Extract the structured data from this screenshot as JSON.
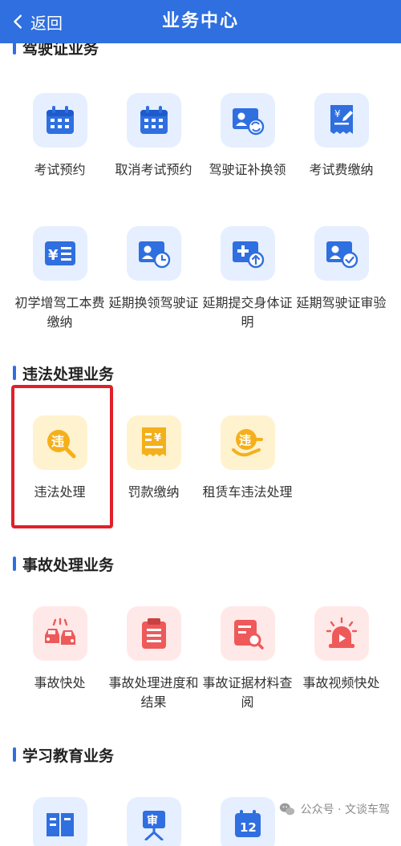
{
  "navbar": {
    "back_label": "返回",
    "title": "业务中心"
  },
  "colors": {
    "primary": "#2f6fe0",
    "highlight": "#e0202a",
    "yellow": "#f4b01c",
    "red": "#ee5a5a"
  },
  "sections": [
    {
      "title": "驾驶证业务",
      "items": [
        {
          "label": "考试预约",
          "icon": "calendar-icon"
        },
        {
          "label": "取消考试预约",
          "icon": "calendar-icon"
        },
        {
          "label": "驾驶证补换领",
          "icon": "license-renew-icon"
        },
        {
          "label": "考试费缴纳",
          "icon": "fee-receipt-icon"
        },
        {
          "label": "初学增驾工本费缴纳",
          "icon": "payment-list-icon"
        },
        {
          "label": "延期换领驾驶证",
          "icon": "license-clock-icon"
        },
        {
          "label": "延期提交身体证明",
          "icon": "medical-upload-icon"
        },
        {
          "label": "延期驾驶证审验",
          "icon": "license-check-icon"
        }
      ]
    },
    {
      "title": "违法处理业务",
      "items": [
        {
          "label": "违法处理",
          "icon": "violation-search-icon"
        },
        {
          "label": "罚款缴纳",
          "icon": "fine-receipt-icon"
        },
        {
          "label": "租赁车违法处理",
          "icon": "rental-violation-icon"
        }
      ]
    },
    {
      "title": "事故处理业务",
      "items": [
        {
          "label": "事故快处",
          "icon": "car-collision-icon"
        },
        {
          "label": "事故处理进度和结果",
          "icon": "clipboard-icon"
        },
        {
          "label": "事故证据材料查阅",
          "icon": "evidence-search-icon"
        },
        {
          "label": "事故视频快处",
          "icon": "alarm-video-icon"
        }
      ]
    },
    {
      "title": "学习教育业务",
      "items": [
        {
          "label": "",
          "icon": "book-icon"
        },
        {
          "label": "审",
          "icon": "review-board-icon"
        },
        {
          "label": "12",
          "icon": "twelve-points-icon"
        }
      ]
    }
  ],
  "watermark": {
    "text": "公众号 · 文谈车驾",
    "icon": "wechat-logo-icon"
  }
}
